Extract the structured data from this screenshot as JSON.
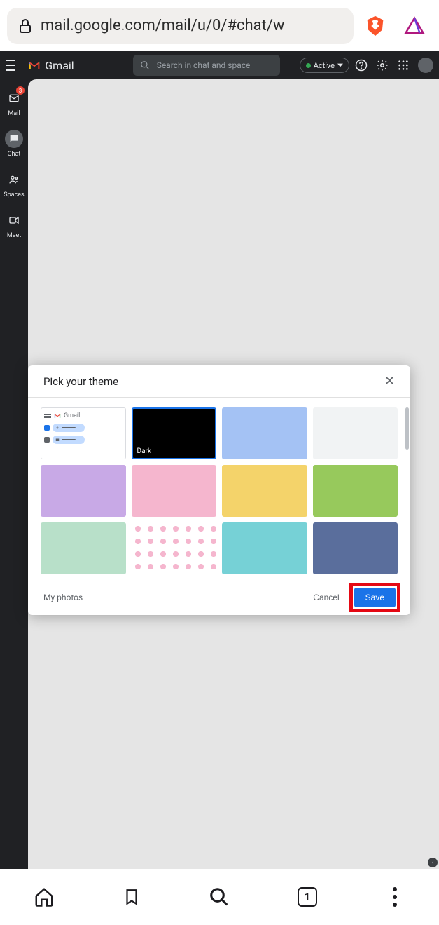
{
  "browser": {
    "url": "mail.google.com/mail/u/0/#chat/w"
  },
  "header": {
    "app_name": "Gmail",
    "search_placeholder": "Search in chat and space",
    "status": "Active"
  },
  "rail": {
    "mail_label": "Mail",
    "mail_badge": "3",
    "chat_label": "Chat",
    "spaces_label": "Spaces",
    "meet_label": "Meet"
  },
  "modal": {
    "title": "Pick your theme",
    "default_tile_text": "Gmail",
    "dark_tile_label": "Dark",
    "my_photos": "My photos",
    "cancel": "Cancel",
    "save": "Save",
    "themes": [
      {
        "name": "default"
      },
      {
        "name": "dark",
        "selected": true,
        "label": "Dark"
      },
      {
        "name": "soft-blue"
      },
      {
        "name": "soft-gray"
      },
      {
        "name": "lavender"
      },
      {
        "name": "rose"
      },
      {
        "name": "mustard"
      },
      {
        "name": "wasabi"
      },
      {
        "name": "seafoam"
      },
      {
        "name": "cherry-blossom"
      },
      {
        "name": "teal"
      },
      {
        "name": "navy"
      }
    ]
  },
  "bottom": {
    "tab_count": "1"
  }
}
